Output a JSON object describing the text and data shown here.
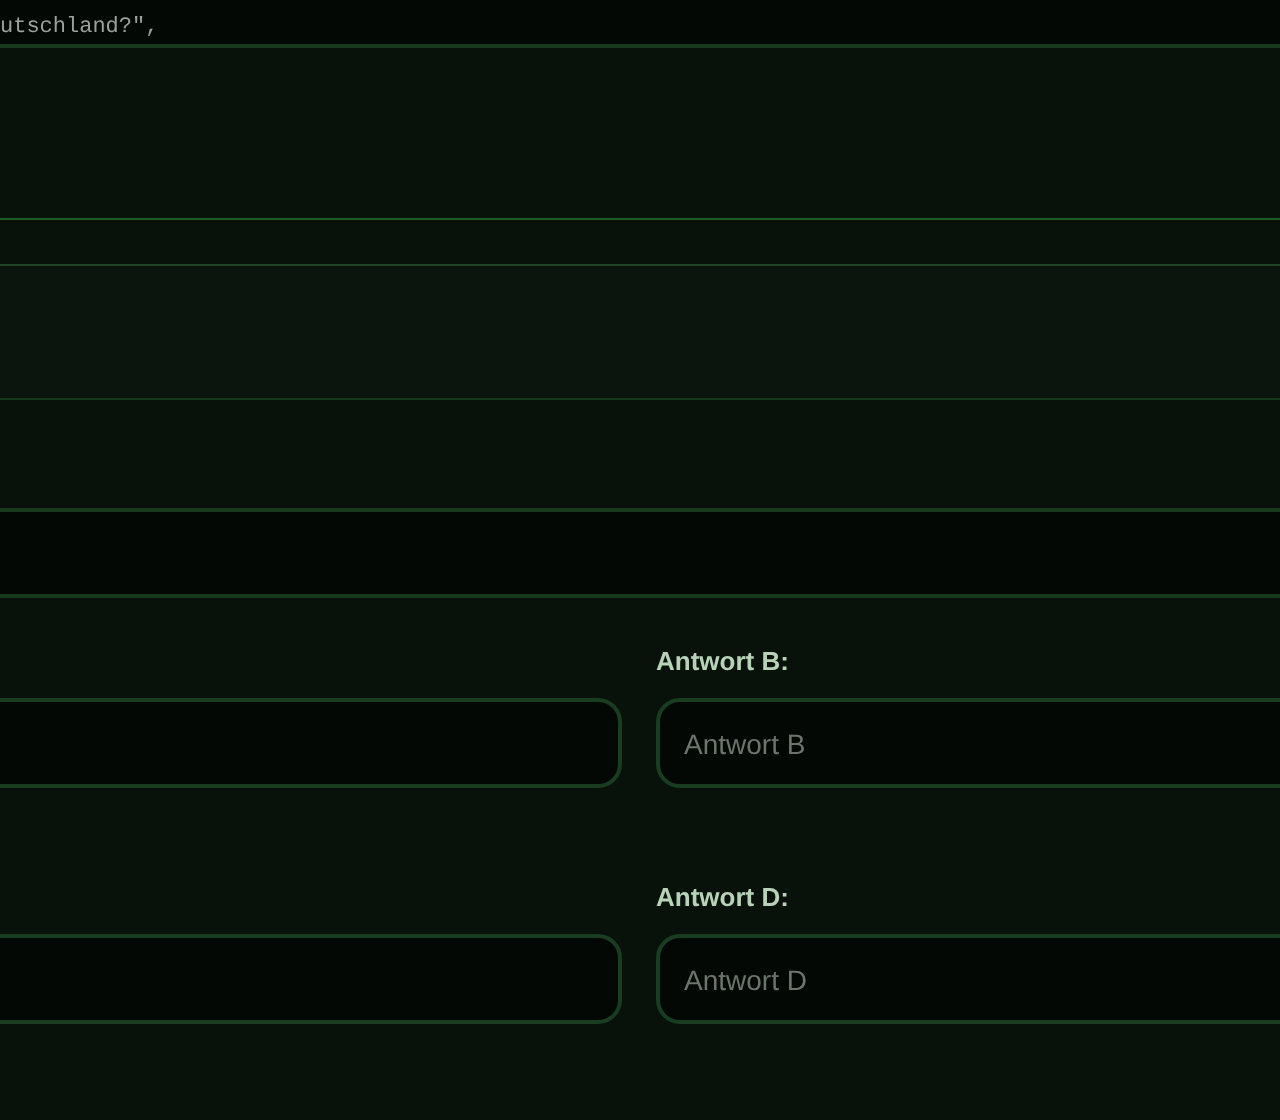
{
  "code_fragment": "utschland?\",",
  "answer_rows": [
    {
      "label": "Antwort B:",
      "placeholder": "Antwort B"
    },
    {
      "label": "Antwort D:",
      "placeholder": "Antwort D"
    }
  ]
}
